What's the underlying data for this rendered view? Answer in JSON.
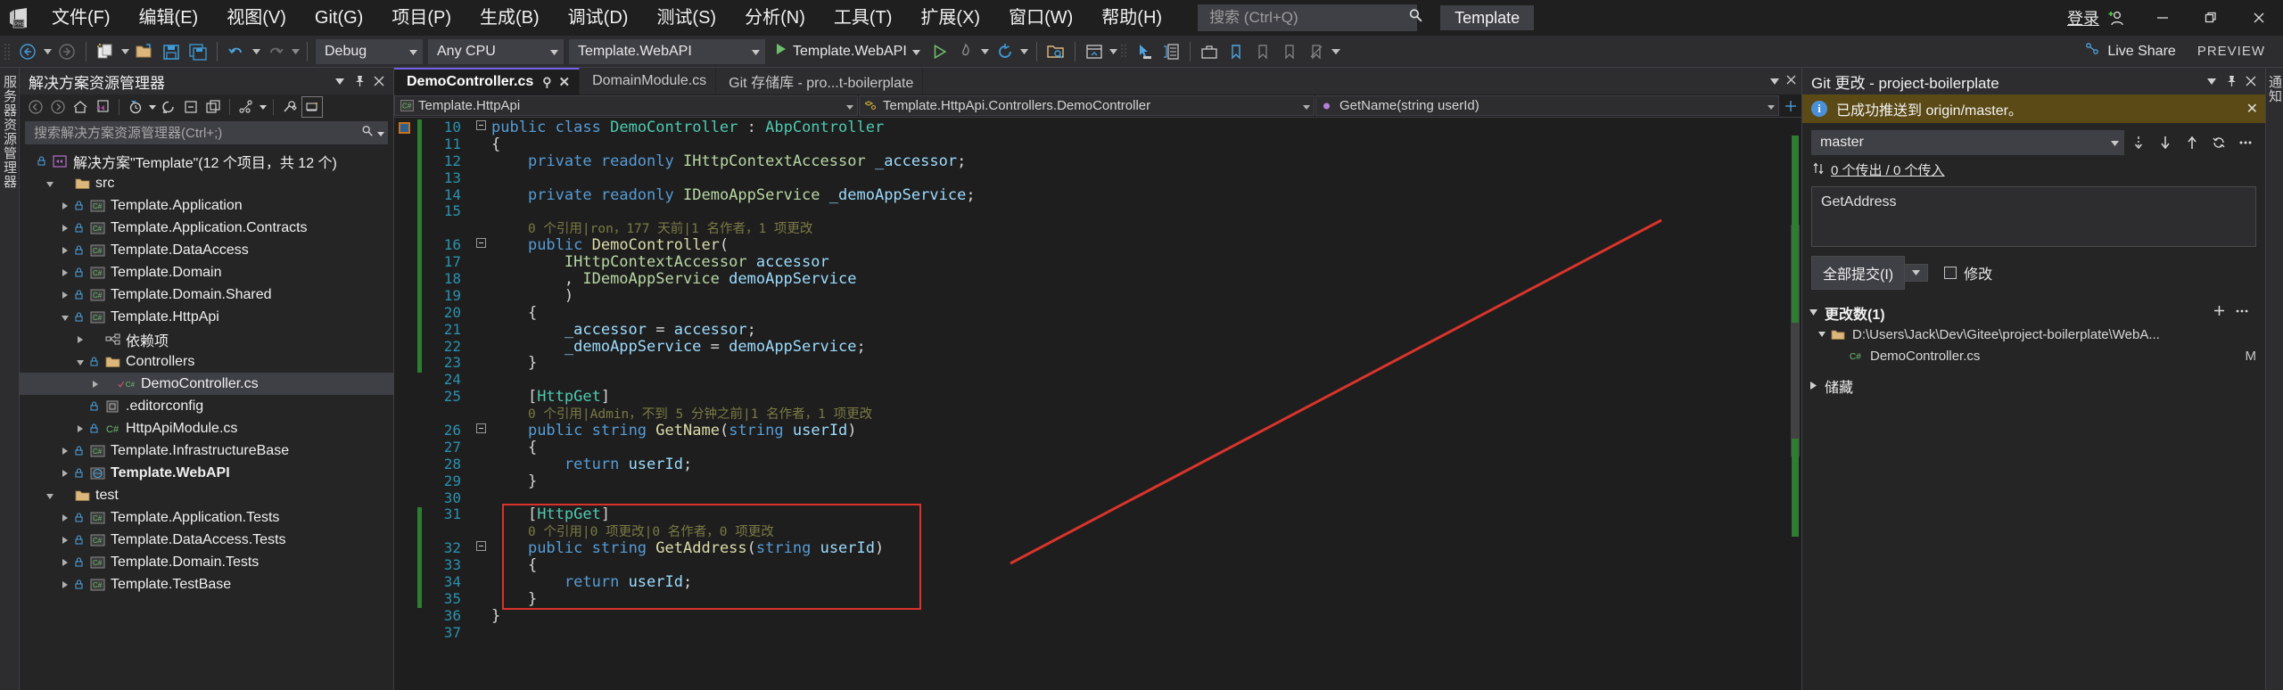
{
  "titlebar": {
    "logo_alt": "visual-studio-logo",
    "menus": [
      "文件(F)",
      "编辑(E)",
      "视图(V)",
      "Git(G)",
      "项目(P)",
      "生成(B)",
      "调试(D)",
      "测试(S)",
      "分析(N)",
      "工具(T)",
      "扩展(X)",
      "窗口(W)",
      "帮助(H)"
    ],
    "search_placeholder": "搜索 (Ctrl+Q)",
    "template_badge": "Template",
    "signin": "登录",
    "minimize": "—",
    "restore": "❐",
    "close": "✕"
  },
  "toolbar": {
    "config": "Debug",
    "platform": "Any CPU",
    "project": "Template.WebAPI",
    "run_label": "Template.WebAPI",
    "live_share": "Live Share",
    "preview": "PREVIEW"
  },
  "leftstrip": {
    "label": "服务器资源管理器"
  },
  "solution": {
    "title": "解决方案资源管理器",
    "search_placeholder": "搜索解决方案资源管理器(Ctrl+;)",
    "root": "解决方案\"Template\"(12 个项目，共 12 个)",
    "tree": [
      {
        "label": "src",
        "indent": 1,
        "icon": "folder",
        "twisty": "expanded",
        "lock": false,
        "selected": false
      },
      {
        "label": "Template.Application",
        "indent": 2,
        "icon": "csproj",
        "twisty": "collapsed",
        "lock": true,
        "selected": false
      },
      {
        "label": "Template.Application.Contracts",
        "indent": 2,
        "icon": "csproj",
        "twisty": "collapsed",
        "lock": true,
        "selected": false
      },
      {
        "label": "Template.DataAccess",
        "indent": 2,
        "icon": "csproj",
        "twisty": "collapsed",
        "lock": true,
        "selected": false
      },
      {
        "label": "Template.Domain",
        "indent": 2,
        "icon": "csproj",
        "twisty": "collapsed",
        "lock": true,
        "selected": false
      },
      {
        "label": "Template.Domain.Shared",
        "indent": 2,
        "icon": "csproj",
        "twisty": "collapsed",
        "lock": true,
        "selected": false
      },
      {
        "label": "Template.HttpApi",
        "indent": 2,
        "icon": "csproj",
        "twisty": "expanded",
        "lock": true,
        "selected": false
      },
      {
        "label": "依赖项",
        "indent": 3,
        "icon": "deps",
        "twisty": "collapsed",
        "lock": false,
        "selected": false
      },
      {
        "label": "Controllers",
        "indent": 3,
        "icon": "folder",
        "twisty": "expanded",
        "lock": true,
        "selected": false
      },
      {
        "label": "DemoController.cs",
        "indent": 4,
        "icon": "cscheck",
        "twisty": "collapsed",
        "lock": false,
        "selected": true
      },
      {
        "label": ".editorconfig",
        "indent": 3,
        "icon": "config",
        "twisty": "none",
        "lock": true,
        "selected": false
      },
      {
        "label": "HttpApiModule.cs",
        "indent": 3,
        "icon": "cs",
        "twisty": "collapsed",
        "lock": true,
        "selected": false
      },
      {
        "label": "Template.InfrastructureBase",
        "indent": 2,
        "icon": "csproj",
        "twisty": "collapsed",
        "lock": true,
        "selected": false
      },
      {
        "label": "Template.WebAPI",
        "indent": 2,
        "icon": "webproj",
        "twisty": "collapsed",
        "lock": true,
        "selected": false,
        "bold": true
      },
      {
        "label": "test",
        "indent": 1,
        "icon": "folder",
        "twisty": "expanded",
        "lock": false,
        "selected": false
      },
      {
        "label": "Template.Application.Tests",
        "indent": 2,
        "icon": "csproj",
        "twisty": "collapsed",
        "lock": true,
        "selected": false
      },
      {
        "label": "Template.DataAccess.Tests",
        "indent": 2,
        "icon": "csproj",
        "twisty": "collapsed",
        "lock": true,
        "selected": false
      },
      {
        "label": "Template.Domain.Tests",
        "indent": 2,
        "icon": "csproj",
        "twisty": "collapsed",
        "lock": true,
        "selected": false
      },
      {
        "label": "Template.TestBase",
        "indent": 2,
        "icon": "csproj",
        "twisty": "collapsed",
        "lock": true,
        "selected": false
      }
    ]
  },
  "editor": {
    "tabs": [
      {
        "label": "DemoController.cs",
        "active": true,
        "closable": true,
        "pinnable": true
      },
      {
        "label": "DomainModule.cs",
        "active": false,
        "closable": false,
        "pinnable": false
      },
      {
        "label": "Git 存储库 - pro...t-boilerplate",
        "active": false,
        "closable": false,
        "pinnable": false
      }
    ],
    "nav": {
      "project": "Template.HttpApi",
      "type": "Template.HttpApi.Controllers.DemoController",
      "member": "GetName(string userId)"
    },
    "lines": [
      {
        "n": 10,
        "fold": "minus",
        "marker": "green",
        "indent": 0,
        "html": "<span class=\"kw\">public</span> <span class=\"kw\">class</span> <span class=\"type\">DemoController</span> : <span class=\"type\">AbpController</span>"
      },
      {
        "n": 11,
        "fold": "",
        "marker": "green",
        "indent": 0,
        "html": "{"
      },
      {
        "n": 12,
        "fold": "",
        "marker": "green",
        "indent": 1,
        "html": "<span class=\"kw\">private</span> <span class=\"kw\">readonly</span> <span class=\"iface\">IHttpContextAccessor</span> <span class=\"fld\">_accessor</span>;"
      },
      {
        "n": 13,
        "fold": "",
        "marker": "green",
        "indent": 1,
        "html": ""
      },
      {
        "n": 14,
        "fold": "",
        "marker": "green",
        "indent": 1,
        "html": "<span class=\"kw\">private</span> <span class=\"kw\">readonly</span> <span class=\"iface\">IDemoAppService</span> <span class=\"fld\">_demoAppService</span>;"
      },
      {
        "n": 15,
        "fold": "",
        "marker": "green",
        "indent": 1,
        "html": ""
      },
      {
        "n": "",
        "fold": "",
        "marker": "green",
        "indent": 1,
        "html": "<span class=\"cref\">0 个引用|ron，177 天前|1 名作者，1 项更改</span>"
      },
      {
        "n": 16,
        "fold": "minus",
        "marker": "green",
        "indent": 1,
        "html": "<span class=\"kw\">public</span> <span class=\"fn\">DemoController</span>("
      },
      {
        "n": 17,
        "fold": "",
        "marker": "green",
        "indent": 2,
        "html": "<span class=\"iface\">IHttpContextAccessor</span> <span class=\"param\">accessor</span>"
      },
      {
        "n": 18,
        "fold": "",
        "marker": "green",
        "indent": 2,
        "html": ", <span class=\"iface\">IDemoAppService</span> <span class=\"param\">demoAppService</span>"
      },
      {
        "n": 19,
        "fold": "",
        "marker": "green",
        "indent": 2,
        "html": ")"
      },
      {
        "n": 20,
        "fold": "",
        "marker": "green",
        "indent": 1,
        "html": "{"
      },
      {
        "n": 21,
        "fold": "",
        "marker": "green",
        "indent": 2,
        "html": "<span class=\"fld\">_accessor</span> = <span class=\"param\">accessor</span>;"
      },
      {
        "n": 22,
        "fold": "",
        "marker": "green",
        "indent": 2,
        "html": "<span class=\"fld\">_demoAppService</span> = <span class=\"param\">demoAppService</span>;"
      },
      {
        "n": 23,
        "fold": "",
        "marker": "green",
        "indent": 1,
        "html": "}"
      },
      {
        "n": 24,
        "fold": "",
        "marker": "",
        "indent": 1,
        "html": ""
      },
      {
        "n": 25,
        "fold": "",
        "marker": "",
        "indent": 1,
        "html": "[<span class=\"attr\">HttpGet</span>]"
      },
      {
        "n": "",
        "fold": "",
        "marker": "",
        "indent": 1,
        "html": "<span class=\"cref\">0 个引用|Admin，不到 5 分钟之前|1 名作者，1 项更改</span>"
      },
      {
        "n": 26,
        "fold": "minus",
        "marker": "",
        "indent": 1,
        "html": "<span class=\"kw\">public</span> <span class=\"kw\">string</span> <span class=\"fn\">GetName</span>(<span class=\"kw\">string</span> <span class=\"param\">userId</span>)"
      },
      {
        "n": 27,
        "fold": "",
        "marker": "",
        "indent": 1,
        "html": "{"
      },
      {
        "n": 28,
        "fold": "",
        "marker": "",
        "indent": 2,
        "html": "<span class=\"kw\">return</span> <span class=\"param\">userId</span>;"
      },
      {
        "n": 29,
        "fold": "",
        "marker": "",
        "indent": 1,
        "html": "}"
      },
      {
        "n": 30,
        "fold": "",
        "marker": "",
        "indent": 1,
        "html": ""
      },
      {
        "n": 31,
        "fold": "",
        "marker": "green",
        "indent": 1,
        "html": "[<span class=\"attr\">HttpGet</span>]"
      },
      {
        "n": "",
        "fold": "",
        "marker": "green",
        "indent": 1,
        "html": "<span class=\"cref\">0 个引用|0 项更改|0 名作者，0 项更改</span>"
      },
      {
        "n": 32,
        "fold": "minus",
        "marker": "green",
        "indent": 1,
        "html": "<span class=\"kw\">public</span> <span class=\"kw\">string</span> <span class=\"fn\">GetAddress</span>(<span class=\"kw\">string</span> <span class=\"param\">userId</span>)"
      },
      {
        "n": 33,
        "fold": "",
        "marker": "green",
        "indent": 1,
        "html": "{"
      },
      {
        "n": 34,
        "fold": "",
        "marker": "green",
        "indent": 2,
        "html": "<span class=\"kw\">return</span> <span class=\"param\">userId</span>;"
      },
      {
        "n": 35,
        "fold": "",
        "marker": "green",
        "indent": 1,
        "html": "}"
      },
      {
        "n": 36,
        "fold": "",
        "marker": "",
        "indent": 0,
        "html": "}"
      },
      {
        "n": 37,
        "fold": "",
        "marker": "",
        "indent": 0,
        "html": ""
      }
    ],
    "annotation": {
      "highlight_color": "#d9342b",
      "highlight_target": "GetAddress-method"
    }
  },
  "git": {
    "title": "Git 更改 - project-boilerplate",
    "notification": "已成功推送到 origin/master。",
    "branch": "master",
    "counts": "0 个传出 / 0 个传入",
    "commit_message": "GetAddress",
    "commit_button": "全部提交(I)",
    "amend_label": "修改",
    "changes_header": "更改数(1)",
    "changes": [
      {
        "label": "D:\\Users\\Jack\\Dev\\Gitee\\project-boilerplate\\WebA...",
        "type": "folder",
        "status": ""
      },
      {
        "label": "DemoController.cs",
        "type": "cs",
        "status": "M"
      }
    ],
    "stash_header": "储藏"
  },
  "colors": {
    "accent": "#7160e8",
    "annotation_red": "#d9342b",
    "notify_bg": "#5b4a16",
    "added_green": "#2e7d32"
  }
}
